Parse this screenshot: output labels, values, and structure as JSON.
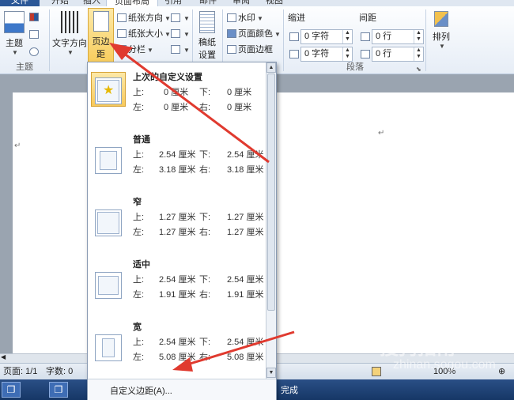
{
  "tabs": [
    "文件",
    "开始",
    "插入",
    "页面布局",
    "引用",
    "邮件",
    "审阅",
    "视图"
  ],
  "ribbon": {
    "theme_group": {
      "label": "主题",
      "theme_button": "主题"
    },
    "page_setup": {
      "text_direction": "文字方向",
      "margins": "页边距",
      "orientation": "纸张方向",
      "size": "纸张大小",
      "columns": "分栏",
      "manuscript_line1": "稿纸",
      "manuscript_line2": "设置"
    },
    "background": {
      "watermark": "水印",
      "page_color": "页面颜色",
      "page_borders": "页面边框"
    },
    "paragraph": {
      "label": "段落",
      "indent_label": "缩进",
      "spacing_label": "间距",
      "indent_left": "0 字符",
      "indent_right": "0 字符",
      "spacing_before": "0 行",
      "spacing_after": "0 行"
    },
    "arrange": {
      "label": "排列"
    }
  },
  "gallery": {
    "items": [
      {
        "name": "上次的自定义设置",
        "top": "0 厘米",
        "bottom": "0 厘米",
        "left": "0 厘米",
        "right": "0 厘米"
      },
      {
        "name": "普通",
        "top": "2.54 厘米",
        "bottom": "2.54 厘米",
        "left": "3.18 厘米",
        "right": "3.18 厘米"
      },
      {
        "name": "窄",
        "top": "1.27 厘米",
        "bottom": "1.27 厘米",
        "left": "1.27 厘米",
        "right": "1.27 厘米"
      },
      {
        "name": "适中",
        "top": "2.54 厘米",
        "bottom": "2.54 厘米",
        "left": "1.91 厘米",
        "right": "1.91 厘米"
      },
      {
        "name": "宽",
        "top": "2.54 厘米",
        "bottom": "2.54 厘米",
        "left": "5.08 厘米",
        "right": "5.08 厘米"
      }
    ],
    "labels": {
      "top": "上:",
      "bottom": "下:",
      "left": "左:",
      "right": "右:"
    },
    "custom": "自定义边距(A)..."
  },
  "status": {
    "page": "页面: 1/1",
    "words": "字数: 0",
    "zoom": "100%"
  },
  "taskbar": {
    "status_text": "完成"
  },
  "watermark": {
    "brand": "搜狗指南",
    "url": "zhinan.sogou.com"
  },
  "colors": {
    "accent": "#2b5797",
    "arrow": "#e03a2f",
    "highlight": "#f8cd5d"
  }
}
